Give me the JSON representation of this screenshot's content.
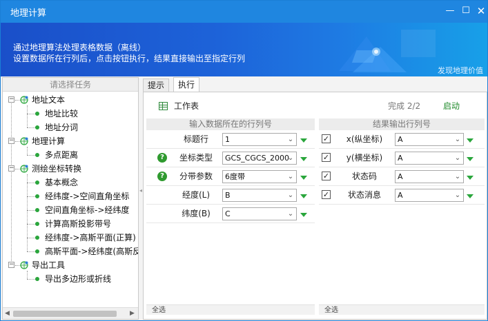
{
  "window": {
    "title": "地理计算",
    "min": "—",
    "max": "☐",
    "close": "✕"
  },
  "banner": {
    "line1": "通过地理算法处理表格数据（离线）",
    "line2": "设置数据所在行列后，点击按钮执行，结果直接输出至指定行列",
    "slogan": "发现地理价值"
  },
  "left_pane": {
    "header": "请选择任务",
    "tree": [
      {
        "label": "地址文本",
        "level": 0,
        "expander": "−"
      },
      {
        "label": "地址比较",
        "level": 1
      },
      {
        "label": "地址分词",
        "level": 1
      },
      {
        "label": "地理计算",
        "level": 0,
        "expander": "−"
      },
      {
        "label": "多点距离",
        "level": 1
      },
      {
        "label": "测绘坐标转换",
        "level": 0,
        "expander": "−"
      },
      {
        "label": "基本概念",
        "level": 1
      },
      {
        "label": "经纬度->空间直角坐标",
        "level": 1
      },
      {
        "label": "空间直角坐标->经纬度",
        "level": 1
      },
      {
        "label": "计算高斯投影带号",
        "level": 1
      },
      {
        "label": "经纬度->高斯平面(正算)",
        "level": 1
      },
      {
        "label": "高斯平面->经纬度(高斯反",
        "level": 1
      },
      {
        "label": "导出工具",
        "level": 0,
        "expander": "−"
      },
      {
        "label": "导出多边形或折线",
        "level": 1
      }
    ],
    "scroll_left": "◀",
    "scroll_right": "▶"
  },
  "splitter_grip": "◂",
  "tabs": [
    {
      "label": "提示",
      "active": false
    },
    {
      "label": "执行",
      "active": true
    }
  ],
  "toolbar": {
    "worksheet_label": "工作表",
    "progress": "完成 2/2",
    "start_label": "启动"
  },
  "input_panel": {
    "header": "输入数据所在的行列号",
    "rows": [
      {
        "label": "标题行",
        "value": "1",
        "help": false
      },
      {
        "label": "坐标类型",
        "value": "GCS_CGCS_2000",
        "help": true
      },
      {
        "label": "分带参数",
        "value": "6度带",
        "help": true
      },
      {
        "label": "经度(L)",
        "value": "B",
        "help": false
      },
      {
        "label": "纬度(B)",
        "value": "C",
        "help": false
      }
    ],
    "help_glyph": "?",
    "footer": "全选"
  },
  "output_panel": {
    "header": "结果输出行列号",
    "rows": [
      {
        "label": "x(纵坐标)",
        "value": "A",
        "checked": true
      },
      {
        "label": "y(横坐标)",
        "value": "A",
        "checked": true
      },
      {
        "label": "状态码",
        "value": "A",
        "checked": true
      },
      {
        "label": "状态消息",
        "value": "A",
        "checked": true
      }
    ],
    "check_glyph": "✓",
    "footer": "全选"
  },
  "select_chevron": "⌄",
  "colors": {
    "titlebar": "#1f86e0",
    "accent_green": "#2aa63c",
    "start_green": "#1f8a2a"
  }
}
